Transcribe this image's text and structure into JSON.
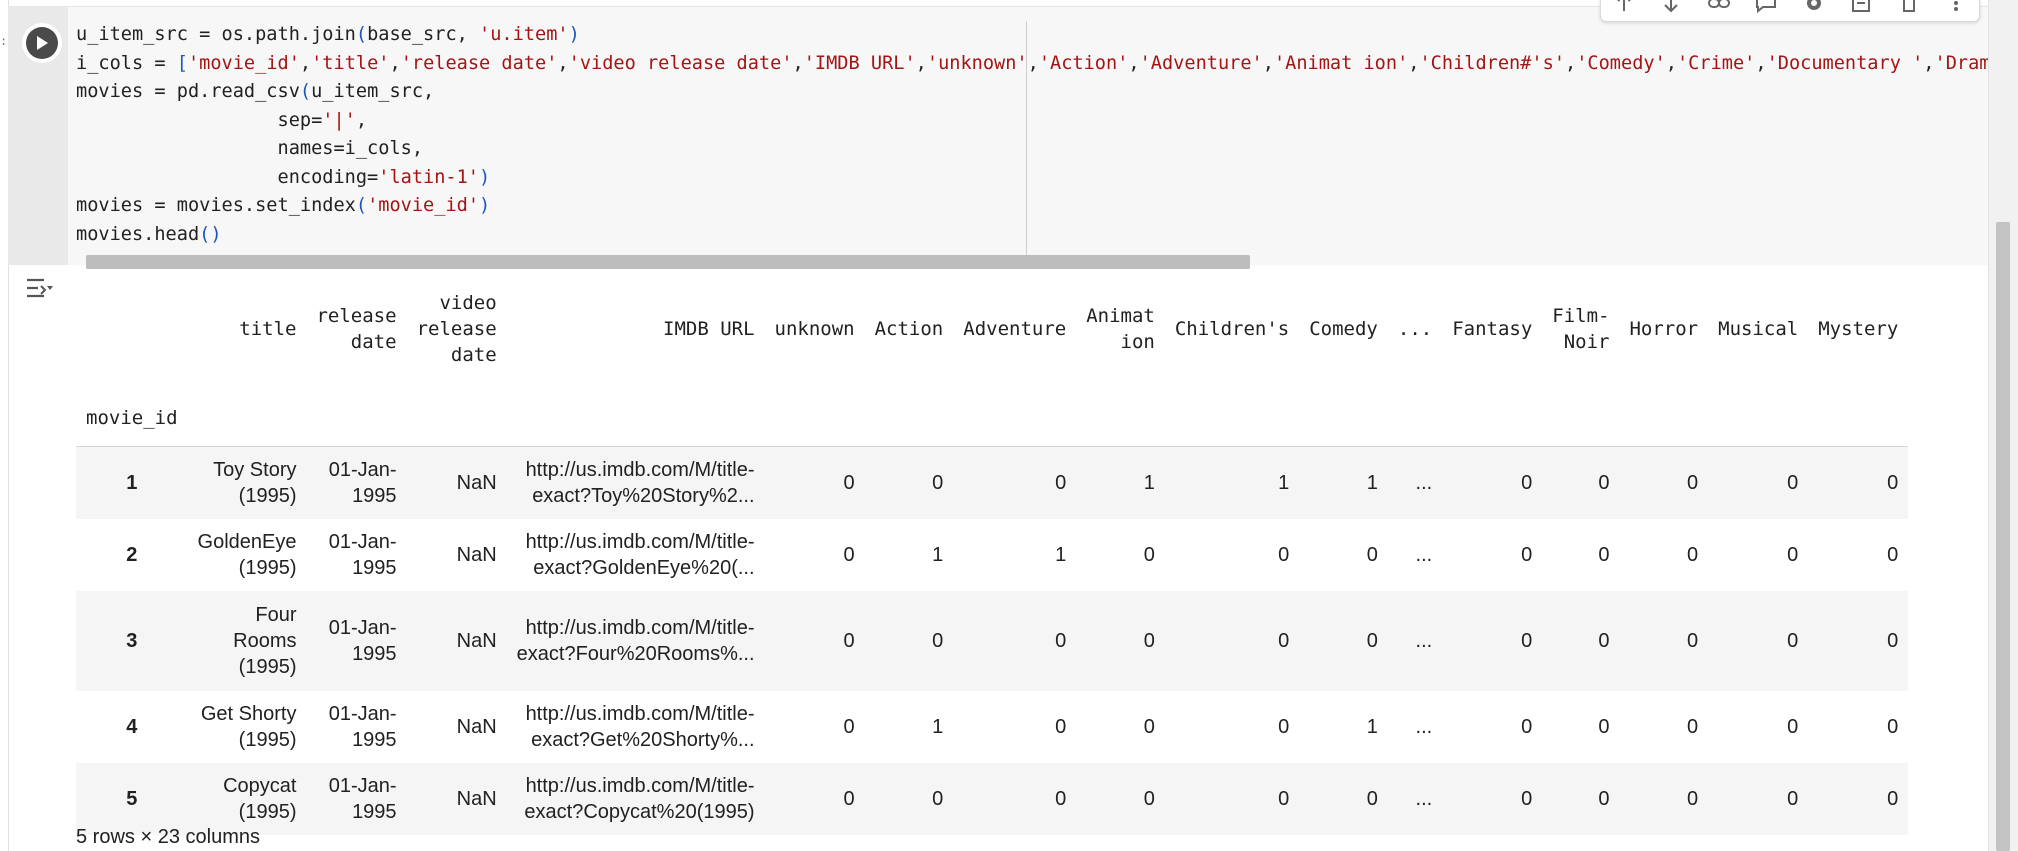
{
  "gutter": {
    "marker": ":"
  },
  "code": {
    "lines": [
      [
        {
          "t": "u_item_src = os.path.join",
          "c": ""
        },
        {
          "t": "(",
          "c": "par"
        },
        {
          "t": "base_src, ",
          "c": ""
        },
        {
          "t": "'u.item'",
          "c": "str"
        },
        {
          "t": ")",
          "c": "par"
        }
      ],
      [
        {
          "t": "i_cols = ",
          "c": ""
        },
        {
          "t": "[",
          "c": "par"
        },
        {
          "t": "'movie_id'",
          "c": "str"
        },
        {
          "t": ",",
          "c": ""
        },
        {
          "t": "'title'",
          "c": "str"
        },
        {
          "t": ",",
          "c": ""
        },
        {
          "t": "'release date'",
          "c": "str"
        },
        {
          "t": ",",
          "c": ""
        },
        {
          "t": "'video release date'",
          "c": "str"
        },
        {
          "t": ",",
          "c": ""
        },
        {
          "t": "'IMDB URL'",
          "c": "str"
        },
        {
          "t": ",",
          "c": ""
        },
        {
          "t": "'unknown'",
          "c": "str"
        },
        {
          "t": ",",
          "c": ""
        },
        {
          "t": "'Action'",
          "c": "str"
        },
        {
          "t": ",",
          "c": ""
        },
        {
          "t": "'Adventure'",
          "c": "str"
        },
        {
          "t": ",",
          "c": ""
        },
        {
          "t": "'Animat ion'",
          "c": "str"
        },
        {
          "t": ",",
          "c": ""
        },
        {
          "t": "'Children#'s'",
          "c": "str"
        },
        {
          "t": ",",
          "c": ""
        },
        {
          "t": "'Comedy'",
          "c": "str"
        },
        {
          "t": ",",
          "c": ""
        },
        {
          "t": "'Crime'",
          "c": "str"
        },
        {
          "t": ",",
          "c": ""
        },
        {
          "t": "'Documentary '",
          "c": "str"
        },
        {
          "t": ",",
          "c": ""
        },
        {
          "t": "'Drama'",
          "c": "str"
        }
      ],
      [
        {
          "t": "movies = pd.read_csv",
          "c": ""
        },
        {
          "t": "(",
          "c": "par"
        },
        {
          "t": "u_item_src,",
          "c": ""
        }
      ],
      [
        {
          "t": "                  sep=",
          "c": ""
        },
        {
          "t": "'|'",
          "c": "str"
        },
        {
          "t": ",",
          "c": ""
        }
      ],
      [
        {
          "t": "                  names=i_cols,",
          "c": ""
        }
      ],
      [
        {
          "t": "                  encoding=",
          "c": ""
        },
        {
          "t": "'latin-1'",
          "c": "str"
        },
        {
          "t": ")",
          "c": "par"
        }
      ],
      [
        {
          "t": "movies = movies.set_index",
          "c": ""
        },
        {
          "t": "(",
          "c": "par"
        },
        {
          "t": "'movie_id'",
          "c": "str"
        },
        {
          "t": ")",
          "c": "par"
        }
      ],
      [
        {
          "t": "movies.head",
          "c": ""
        },
        {
          "t": "()",
          "c": "par"
        }
      ]
    ]
  },
  "toolbar": {
    "icons": [
      "arrow-up-icon",
      "arrow-down-icon",
      "link-icon",
      "comment-icon",
      "gear-icon",
      "mirror-cell-icon",
      "delete-icon",
      "more-vert-icon"
    ]
  },
  "output": {
    "index_name": "movie_id",
    "columns": [
      "title",
      "release\ndate",
      "video\nrelease\ndate",
      "IMDB URL",
      "unknown",
      "Action",
      "Adventure",
      "Animat\nion",
      "Children's",
      "Comedy",
      "...",
      "Fantasy",
      "Film-\nNoir",
      "Horror",
      "Musical",
      "Mystery"
    ],
    "rows": [
      {
        "id": "1",
        "title": "Toy Story\n(1995)",
        "release": "01-Jan-\n1995",
        "video": "NaN",
        "url": "http://us.imdb.com/M/title-\nexact?Toy%20Story%2...",
        "vals": [
          "0",
          "0",
          "0",
          "1",
          "1",
          "1",
          "...",
          "0",
          "0",
          "0",
          "0",
          "0"
        ]
      },
      {
        "id": "2",
        "title": "GoldenEye\n(1995)",
        "release": "01-Jan-\n1995",
        "video": "NaN",
        "url": "http://us.imdb.com/M/title-\nexact?GoldenEye%20(...",
        "vals": [
          "0",
          "1",
          "1",
          "0",
          "0",
          "0",
          "...",
          "0",
          "0",
          "0",
          "0",
          "0"
        ]
      },
      {
        "id": "3",
        "title": "Four\nRooms\n(1995)",
        "release": "01-Jan-\n1995",
        "video": "NaN",
        "url": "http://us.imdb.com/M/title-\nexact?Four%20Rooms%...",
        "vals": [
          "0",
          "0",
          "0",
          "0",
          "0",
          "0",
          "...",
          "0",
          "0",
          "0",
          "0",
          "0"
        ]
      },
      {
        "id": "4",
        "title": "Get Shorty\n(1995)",
        "release": "01-Jan-\n1995",
        "video": "NaN",
        "url": "http://us.imdb.com/M/title-\nexact?Get%20Shorty%...",
        "vals": [
          "0",
          "1",
          "0",
          "0",
          "0",
          "1",
          "...",
          "0",
          "0",
          "0",
          "0",
          "0"
        ]
      },
      {
        "id": "5",
        "title": "Copycat\n(1995)",
        "release": "01-Jan-\n1995",
        "video": "NaN",
        "url": "http://us.imdb.com/M/title-\nexact?Copycat%20(1995)",
        "vals": [
          "0",
          "0",
          "0",
          "0",
          "0",
          "0",
          "...",
          "0",
          "0",
          "0",
          "0",
          "0"
        ]
      }
    ],
    "footer": "5 rows × 23 columns"
  },
  "colors": {
    "string": "#a31515",
    "paren": "#1c58b8",
    "code_bg": "#f7f7f7",
    "scrollbar": "#bdbdbd"
  }
}
